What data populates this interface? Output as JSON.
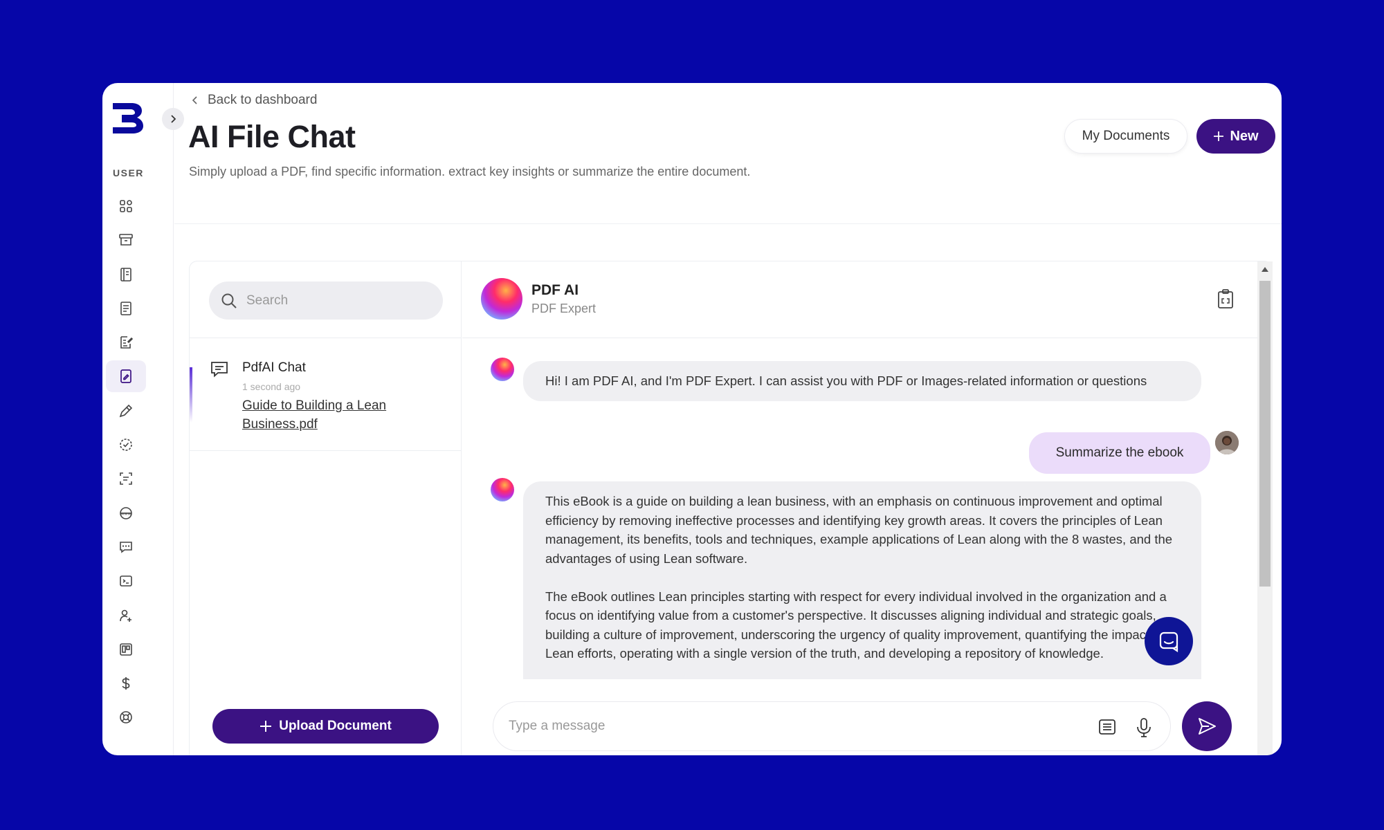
{
  "header": {
    "back_label": "Back to dashboard",
    "title": "AI File Chat",
    "subtitle": "Simply upload a PDF, find specific information. extract key insights or summarize the entire document.",
    "my_documents_label": "My Documents",
    "new_label": "New"
  },
  "sidebar": {
    "section_label": "USER",
    "items": [
      {
        "icon": "grid-icon"
      },
      {
        "icon": "archive-icon"
      },
      {
        "icon": "notebook-icon"
      },
      {
        "icon": "document-icon"
      },
      {
        "icon": "document-edit-icon"
      },
      {
        "icon": "file-chat-icon",
        "active": true
      },
      {
        "icon": "pen-icon"
      },
      {
        "icon": "check-circle-icon"
      },
      {
        "icon": "scan-text-icon"
      },
      {
        "icon": "www-icon"
      },
      {
        "icon": "chat-icon"
      },
      {
        "icon": "terminal-icon"
      },
      {
        "icon": "add-user-icon"
      },
      {
        "icon": "board-icon"
      },
      {
        "icon": "dollar-icon"
      },
      {
        "icon": "lifebuoy-icon"
      }
    ]
  },
  "list": {
    "search_placeholder": "Search",
    "chat_title": "PdfAI Chat",
    "chat_time": "1 second ago",
    "chat_file": "Guide to Building a Lean Business.pdf",
    "upload_label": "Upload Document"
  },
  "chat": {
    "bot_name": "PDF AI",
    "bot_role": "PDF Expert",
    "messages": [
      {
        "from": "bot",
        "text": "Hi! I am PDF AI, and I'm PDF Expert. I can assist you with PDF or Images-related information or questions"
      },
      {
        "from": "user",
        "text": "Summarize the ebook"
      },
      {
        "from": "bot",
        "paragraphs": [
          "This eBook is a guide on building a lean business, with an emphasis on continuous improvement and optimal efficiency by removing ineffective processes and identifying key growth areas. It covers the principles of Lean management, its benefits, tools and techniques, example applications of Lean along with the 8 wastes, and the advantages of using Lean software.",
          "The eBook outlines Lean principles starting with respect for every individual involved in the organization and a focus on identifying value from a customer's perspective. It discusses aligning individual and strategic goals, building a culture of improvement, underscoring the urgency of quality improvement, quantifying the impact of Lean efforts, operating with a single version of the truth, and developing a repository of knowledge."
        ]
      }
    ],
    "composer_placeholder": "Type a message"
  },
  "colors": {
    "background": "#0606a8",
    "accent": "#3b1283",
    "user_bubble": "#ebdcfa",
    "bot_bubble": "#efeff2"
  }
}
